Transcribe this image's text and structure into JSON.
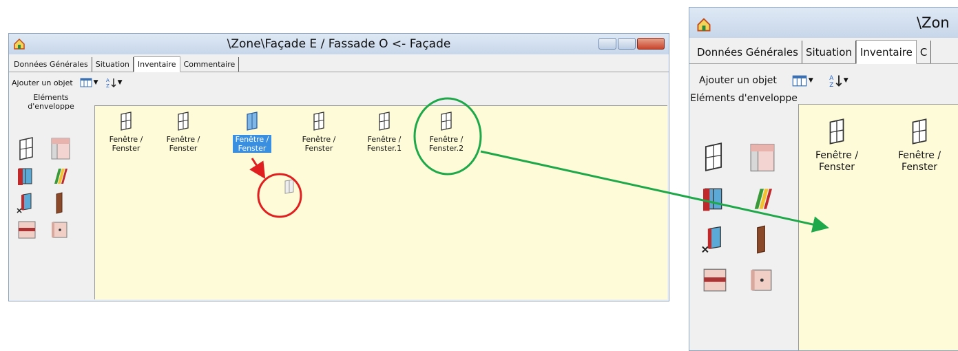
{
  "left_window": {
    "title": "\\Zone\\Façade E / Fassade O <- Façade",
    "tabs": [
      {
        "label": "Données Générales",
        "active": false
      },
      {
        "label": "Situation",
        "active": false
      },
      {
        "label": "Inventaire",
        "active": true
      },
      {
        "label": "Commentaire",
        "active": false
      }
    ],
    "add_object_label": "Ajouter un objet",
    "left_panel_title": "Eléments d'enveloppe",
    "items": [
      {
        "line1": "Fenêtre /",
        "line2": "Fenster",
        "selected": false
      },
      {
        "line1": "Fenêtre /",
        "line2": "Fenster",
        "selected": false
      },
      {
        "line1": "Fenêtre /",
        "line2": "Fenster",
        "selected": true
      },
      {
        "line1": "Fenêtre /",
        "line2": "Fenster",
        "selected": false
      },
      {
        "line1": "Fenêtre /",
        "line2": "Fenster.1",
        "selected": false
      },
      {
        "line1": "Fenêtre /",
        "line2": "Fenster.2",
        "selected": false
      }
    ]
  },
  "right_window": {
    "title": "\\Zon",
    "tabs": [
      {
        "label": "Données Générales",
        "active": false
      },
      {
        "label": "Situation",
        "active": false
      },
      {
        "label": "Inventaire",
        "active": true
      },
      {
        "label": "C",
        "active": false
      }
    ],
    "add_object_label": "Ajouter un objet",
    "left_panel_title": "Eléments d'enveloppe",
    "items": [
      {
        "line1": "Fenêtre /",
        "line2": "Fenster"
      },
      {
        "line1": "Fenêtre /",
        "line2": "Fenster"
      }
    ]
  },
  "colors": {
    "pane_bg": "#fefbd8",
    "selection": "#3a8fe0",
    "annotation_red": "#e02020",
    "annotation_green": "#1fa84a"
  }
}
